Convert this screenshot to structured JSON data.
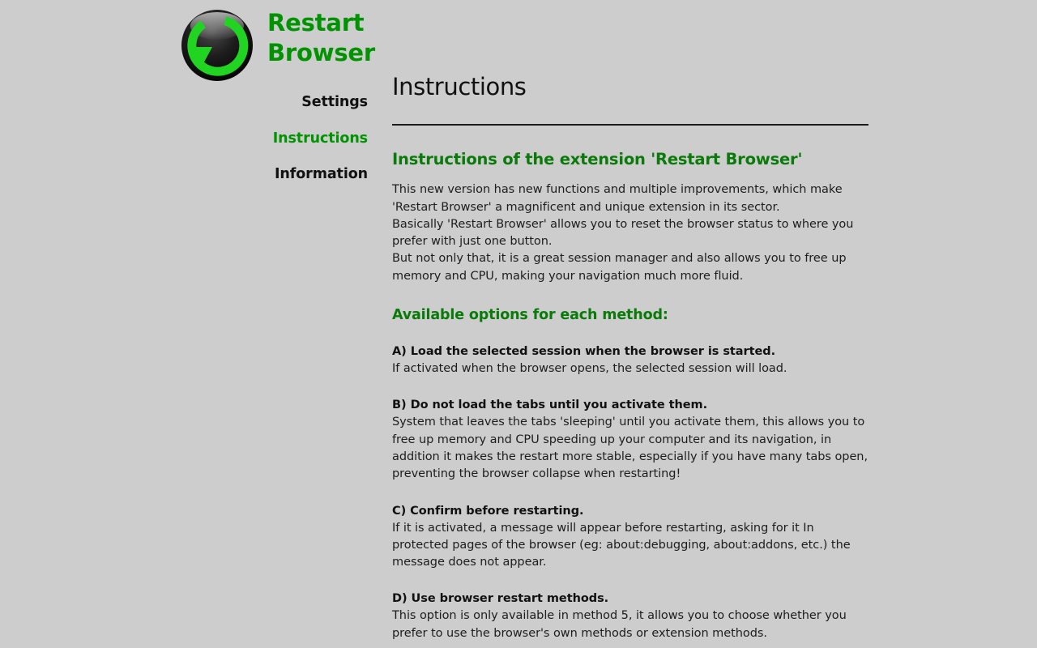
{
  "app": {
    "brand_name": "Restart\nBrowser",
    "logo_icon": "restart-circular-arrow-icon",
    "accent_green": "#029302",
    "heading_green": "#0a7a0a",
    "background": "#cdcdcd",
    "logo_arrow_color": "#22d422"
  },
  "nav": {
    "items": [
      {
        "label": "Settings",
        "active": false
      },
      {
        "label": "Instructions",
        "active": true
      },
      {
        "label": "Information",
        "active": false
      }
    ]
  },
  "main": {
    "page_title": "Instructions",
    "section_heading": "Instructions of the extension 'Restart Browser'",
    "intro_lines": [
      "This new version has new functions and multiple improvements, which make 'Restart Browser' a magnificent and unique extension in its sector.",
      "Basically 'Restart Browser' allows you to reset the browser status to where you prefer with just one button.",
      "But not only that, it is a great session manager and also allows you to free up memory and CPU, making your navigation much more fluid."
    ],
    "options_heading": "Available options for each method:",
    "options": [
      {
        "title": "A) Load the selected session when the browser is started.",
        "body": "If activated when the browser opens, the selected session will load."
      },
      {
        "title": "B) Do not load the tabs until you activate them.",
        "body": "System that leaves the tabs 'sleeping' until you activate them, this allows you to free up memory and CPU speeding up your computer and its navigation, in addition it makes the restart more stable, especially if you have many tabs open, preventing the browser collapse when restarting!"
      },
      {
        "title": "C) Confirm before restarting.",
        "body": "If it is activated, a message will appear before restarting, asking for it In protected pages of the browser (eg: about:debugging, about:addons, etc.) the message does not appear."
      },
      {
        "title": "D) Use browser restart methods.",
        "body": "This option is only available in method 5, it allows you to choose whether you prefer to use the browser's own methods or extension methods."
      }
    ]
  }
}
